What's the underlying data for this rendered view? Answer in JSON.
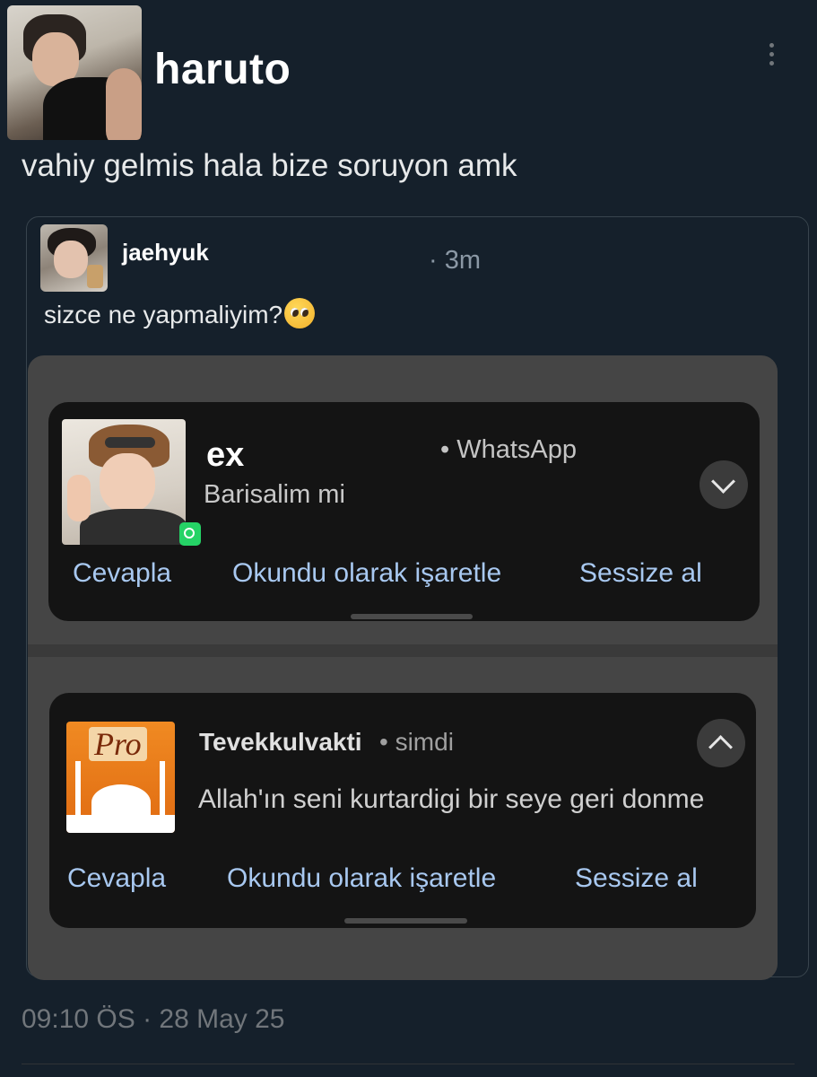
{
  "tweet": {
    "author": "haruto",
    "text": "vahiy gelmis hala bize soruyon amk",
    "footer": "09:10 ÖS · 28 May 25"
  },
  "quote": {
    "author": "jaehyuk",
    "time": "· 3m",
    "text": "sizce ne yapmaliyim?"
  },
  "notifications": [
    {
      "title": "ex",
      "app": "• WhatsApp",
      "message": "Barisalim mi",
      "actions": [
        "Cevapla",
        "Okundu olarak işaretle",
        "Sessize al"
      ]
    },
    {
      "title": "Tevekkulvakti",
      "app": "• simdi",
      "message": "Allah'ın seni kurtardigi bir seye geri donme",
      "icon_text": "Pro",
      "actions": [
        "Cevapla",
        "Okundu olarak işaretle",
        "Sessize al"
      ]
    }
  ],
  "icons": {
    "more": "more-vertical-icon",
    "expand": "chevron-down-icon",
    "collapse": "chevron-up-icon",
    "whatsapp": "whatsapp-icon",
    "emoji": "pleading-face-emoji"
  },
  "colors": {
    "background": "#15202b",
    "action_link": "#a8c8f0",
    "whatsapp_green": "#25d366"
  }
}
